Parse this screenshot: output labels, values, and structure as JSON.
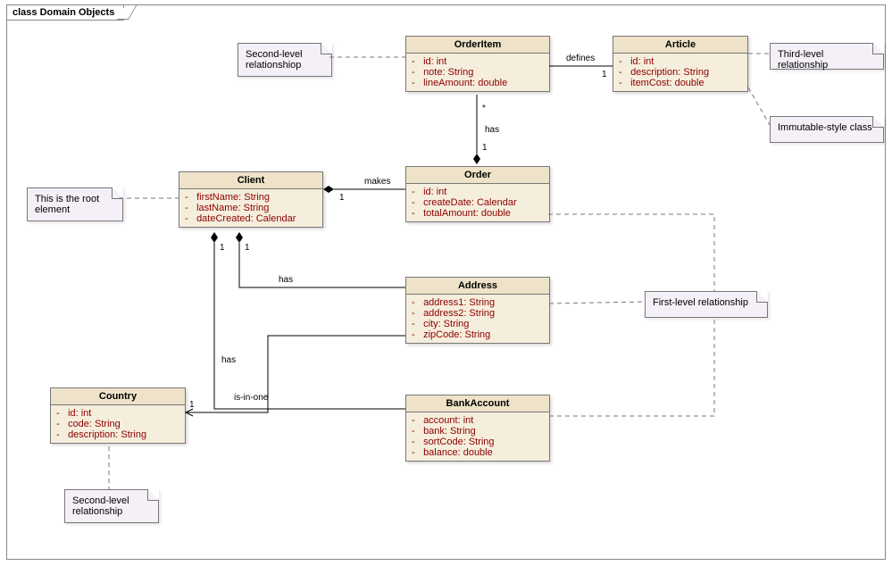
{
  "chart_data": {
    "type": "uml-class-diagram",
    "title": "class Domain Objects",
    "classes": [
      {
        "name": "OrderItem",
        "attributes": [
          {
            "vis": "-",
            "name": "id",
            "type": "int"
          },
          {
            "vis": "-",
            "name": "note",
            "type": "String"
          },
          {
            "vis": "-",
            "name": "lineAmount",
            "type": "double"
          }
        ]
      },
      {
        "name": "Article",
        "attributes": [
          {
            "vis": "-",
            "name": "id",
            "type": "int"
          },
          {
            "vis": "-",
            "name": "description",
            "type": "String"
          },
          {
            "vis": "-",
            "name": "itemCost",
            "type": "double"
          }
        ]
      },
      {
        "name": "Client",
        "attributes": [
          {
            "vis": "-",
            "name": "firstName",
            "type": "String"
          },
          {
            "vis": "-",
            "name": "lastName",
            "type": "String"
          },
          {
            "vis": "-",
            "name": "dateCreated",
            "type": "Calendar"
          }
        ]
      },
      {
        "name": "Order",
        "attributes": [
          {
            "vis": "-",
            "name": "id",
            "type": "int"
          },
          {
            "vis": "-",
            "name": "createDate",
            "type": "Calendar"
          },
          {
            "vis": "-",
            "name": "totalAmount",
            "type": "double"
          }
        ]
      },
      {
        "name": "Address",
        "attributes": [
          {
            "vis": "-",
            "name": "address1",
            "type": "String"
          },
          {
            "vis": "-",
            "name": "address2",
            "type": "String"
          },
          {
            "vis": "-",
            "name": "city",
            "type": "String"
          },
          {
            "vis": "-",
            "name": "zipCode",
            "type": "String"
          }
        ]
      },
      {
        "name": "Country",
        "attributes": [
          {
            "vis": "-",
            "name": "id",
            "type": "int"
          },
          {
            "vis": "-",
            "name": "code",
            "type": "String"
          },
          {
            "vis": "-",
            "name": "description",
            "type": "String"
          }
        ]
      },
      {
        "name": "BankAccount",
        "attributes": [
          {
            "vis": "-",
            "name": "account",
            "type": "int"
          },
          {
            "vis": "-",
            "name": "bank",
            "type": "String"
          },
          {
            "vis": "-",
            "name": "sortCode",
            "type": "String"
          },
          {
            "vis": "-",
            "name": "balance",
            "type": "double"
          }
        ]
      }
    ],
    "relations": [
      {
        "from": "Order",
        "to": "Client",
        "label": "makes",
        "kind": "composition",
        "mult_to": "1"
      },
      {
        "from": "OrderItem",
        "to": "Order",
        "label": "has",
        "kind": "composition",
        "mult_from": "*",
        "mult_to": "1"
      },
      {
        "from": "Article",
        "to": "OrderItem",
        "label": "defines",
        "kind": "association",
        "mult_to": "1"
      },
      {
        "from": "Address",
        "to": "Client",
        "label": "has",
        "kind": "composition",
        "mult_to": "1"
      },
      {
        "from": "BankAccount",
        "to": "Client",
        "label": "has",
        "kind": "composition",
        "mult_to": "1"
      },
      {
        "from": "Address",
        "to": "Country",
        "label": "is-in-one",
        "kind": "association",
        "mult_to": "1"
      }
    ],
    "notes": [
      {
        "text": "Second-level relationshiop",
        "links": [
          "OrderItem"
        ]
      },
      {
        "text": "Third-level relationship",
        "links": [
          "Article"
        ]
      },
      {
        "text": "Immutable-style class",
        "links": [
          "Article"
        ]
      },
      {
        "text": "This is the root element",
        "links": [
          "Client"
        ]
      },
      {
        "text": "First-level relationship",
        "links": [
          "Address",
          "BankAccount",
          "Order"
        ]
      },
      {
        "text": "Second-level relationship",
        "links": [
          "Country"
        ]
      }
    ]
  },
  "frame": {
    "title": "class Domain Objects"
  },
  "notes": {
    "n1": "Second-level relationshiop",
    "n2": "Third-level relationship",
    "n3": "Immutable-style class",
    "n4": "This is the root element",
    "n5": "First-level relationship",
    "n6": "Second-level relationship"
  },
  "cls": {
    "orderitem": {
      "title": "OrderItem",
      "a0v": "-",
      "a0": "id: int",
      "a1v": "-",
      "a1": "note: String",
      "a2v": "-",
      "a2": "lineAmount: double"
    },
    "article": {
      "title": "Article",
      "a0v": "-",
      "a0": "id: int",
      "a1v": "-",
      "a1": "description: String",
      "a2v": "-",
      "a2": "itemCost: double"
    },
    "client": {
      "title": "Client",
      "a0v": "-",
      "a0": "firstName: String",
      "a1v": "-",
      "a1": "lastName: String",
      "a2v": "-",
      "a2": "dateCreated: Calendar"
    },
    "order": {
      "title": "Order",
      "a0v": "-",
      "a0": "id: int",
      "a1v": "-",
      "a1": "createDate: Calendar",
      "a2v": "-",
      "a2": "totalAmount: double"
    },
    "address": {
      "title": "Address",
      "a0v": "-",
      "a0": "address1: String",
      "a1v": "-",
      "a1": "address2: String",
      "a2v": "-",
      "a2": "city: String",
      "a3v": "-",
      "a3": "zipCode: String"
    },
    "country": {
      "title": "Country",
      "a0v": "-",
      "a0": "id: int",
      "a1v": "-",
      "a1": "code: String",
      "a2v": "-",
      "a2": "description: String"
    },
    "bank": {
      "title": "BankAccount",
      "a0v": "-",
      "a0": "account: int",
      "a1v": "-",
      "a1": "bank: String",
      "a2v": "-",
      "a2": "sortCode: String",
      "a3v": "-",
      "a3": "balance: double"
    }
  },
  "rel": {
    "makes": "makes",
    "has": "has",
    "defines": "defines",
    "isinone": "is-in-one",
    "one": "1",
    "star": "*"
  }
}
